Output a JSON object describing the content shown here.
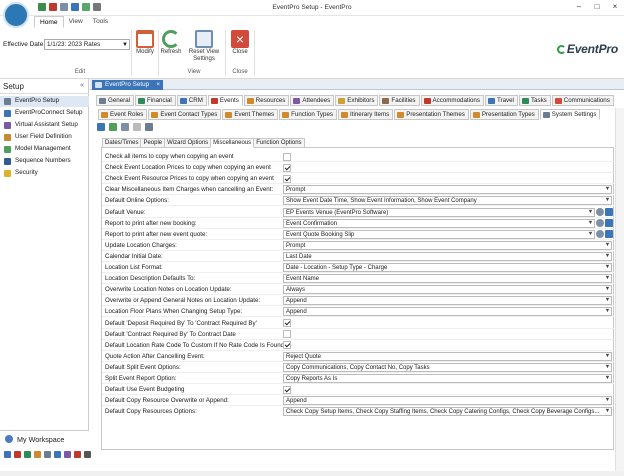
{
  "window": {
    "title": "EventPro Setup - EventPro"
  },
  "ribbon_tabs": [
    "Home",
    "View",
    "Tools"
  ],
  "ribbon": {
    "effective_date_label": "Effective Date",
    "effective_date_value": "1/1/23: 2023 Rates",
    "modify_label": "Modify",
    "refresh_label": "Refresh",
    "reset_view_label": "Reset View Settings",
    "close_label": "Close",
    "group_edit": "Edit",
    "group_view": "View",
    "group_close": "Close",
    "brand": "EventPro"
  },
  "left": {
    "header": "Setup",
    "items": [
      "EventPro Setup",
      "EventProConnect Setup",
      "Virtual Assistant Setup",
      "User Field Definition",
      "Model Management",
      "Sequence Numbers",
      "Security"
    ],
    "workspace": "My Workspace"
  },
  "doc_tab": "EventPro Setup",
  "main_tabs": [
    "General",
    "Financial",
    "CRM",
    "Events",
    "Resources",
    "Attendees",
    "Exhibitors",
    "Facilities",
    "Accommodations",
    "Travel",
    "Tasks",
    "Communications"
  ],
  "event_tabs": [
    "Event Roles",
    "Event Contact Types",
    "Event Themes",
    "Function Types",
    "Itinerary Items",
    "Presentation Themes",
    "Presentation Types",
    "System Settings"
  ],
  "sub_tabs": [
    "Dates/Times",
    "People",
    "Wizard Options",
    "Miscellaneous",
    "Function Options"
  ],
  "settings": [
    {
      "label": "Check all items to copy when copying an event",
      "type": "checkbox",
      "checked": false
    },
    {
      "label": "Check Event Location Prices to copy when copying an event",
      "type": "checkbox",
      "checked": true
    },
    {
      "label": "Check Event Resource Prices to copy when copying an event",
      "type": "checkbox",
      "checked": true
    },
    {
      "label": "Clear Miscellaneous Item Charges when cancelling an Event:",
      "type": "select",
      "value": "Prompt"
    },
    {
      "label": "Default Online Options:",
      "type": "select",
      "value": "Show Event Date Time, Show Event Information, Show Event Company"
    },
    {
      "label": "Default Venue:",
      "type": "lookup",
      "value": "EP Events Venue (EventPro Software)"
    },
    {
      "label": "Report to print after new booking:",
      "type": "lookup",
      "value": "Event Confirmation"
    },
    {
      "label": "Report to print after new event quote:",
      "type": "lookup",
      "value": "Event Quote Booking Slip"
    },
    {
      "label": "Update Location Charges:",
      "type": "select",
      "value": "Prompt"
    },
    {
      "label": "Calendar Initial Date:",
      "type": "select",
      "value": "Last Date"
    },
    {
      "label": "Location List Format:",
      "type": "select",
      "value": "Date - Location - Setup Type - Charge"
    },
    {
      "label": "Location Description Defaults To:",
      "type": "select",
      "value": "Event Name"
    },
    {
      "label": "Overwrite Location Notes on Location Update:",
      "type": "select",
      "value": "Always"
    },
    {
      "label": "Overwrite or Append General Notes on Location Update:",
      "type": "select",
      "value": "Append"
    },
    {
      "label": "Location Floor Plans When Changing Setup Type:",
      "type": "select",
      "value": "Append"
    },
    {
      "label": "Default 'Deposit Required By' To 'Contract Required By'",
      "type": "checkbox",
      "checked": true
    },
    {
      "label": "Default 'Contract Required By' To Contract Date",
      "type": "checkbox",
      "checked": false
    },
    {
      "label": "Default Location Rate Code To Custom If No Rate Code Is Found",
      "type": "checkbox",
      "checked": true
    },
    {
      "label": "Quote Action After Cancelling Event:",
      "type": "select",
      "value": "Reject Quote"
    },
    {
      "label": "Default Split Event Options:",
      "type": "select",
      "value": "Copy Communications, Copy Contact No, Copy Tasks"
    },
    {
      "label": "Split Event Report Option:",
      "type": "select",
      "value": "Copy Reports As Is"
    },
    {
      "label": "Default Use Event Budgeting",
      "type": "checkbox",
      "checked": true
    },
    {
      "label": "Default Copy Resource Overwrite or Append:",
      "type": "select",
      "value": "Append"
    },
    {
      "label": "Default Copy Resources Options:",
      "type": "select",
      "value": "Check Copy Setup Items, Check Copy Staffing Items, Check Copy Catering Configs, Check Copy Beverage Configs..."
    }
  ],
  "colors": {
    "accent": "#3b74b8",
    "brand_green": "#2e9e45"
  }
}
